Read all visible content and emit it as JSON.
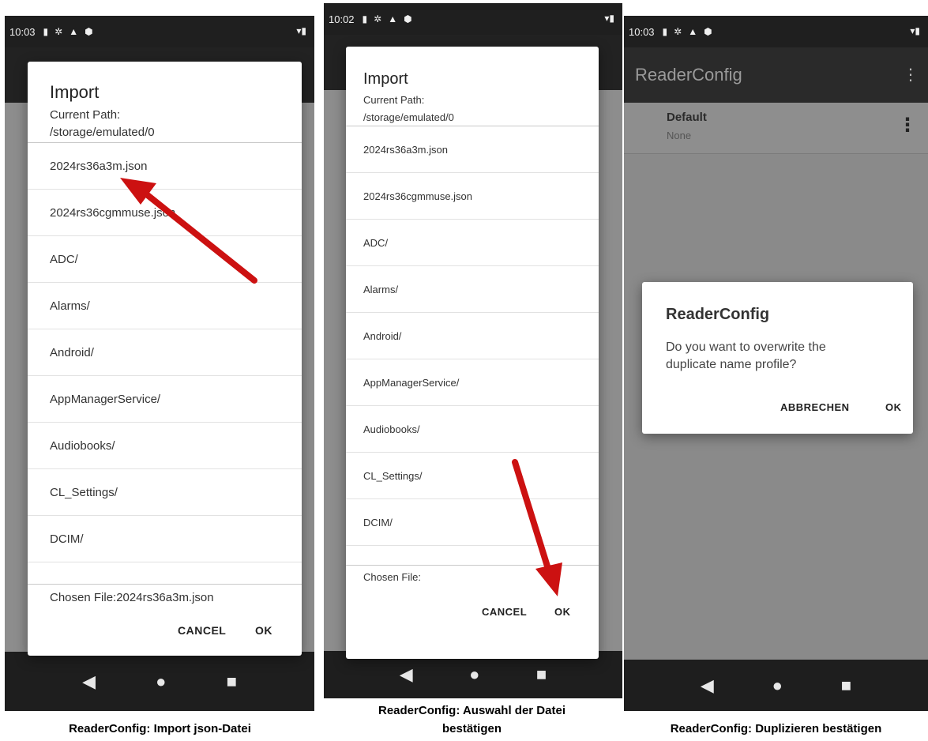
{
  "screen1": {
    "status": {
      "time": "10:03"
    },
    "dialog": {
      "title": "Import",
      "path_label": "Current Path:",
      "path_value": "/storage/emulated/0",
      "files": [
        "2024rs36a3m.json",
        "2024rs36cgmmuse.json",
        "ADC/",
        "Alarms/",
        "Android/",
        "AppManagerService/",
        "Audiobooks/",
        "CL_Settings/",
        "DCIM/"
      ],
      "chosen": "Chosen File:2024rs36a3m.json",
      "cancel": "CANCEL",
      "ok": "OK"
    },
    "caption": "ReaderConfig: Import json-Datei"
  },
  "screen2": {
    "status": {
      "time": "10:02"
    },
    "dialog": {
      "title": "Import",
      "path_label": "Current Path:",
      "path_value": "/storage/emulated/0",
      "files": [
        "2024rs36a3m.json",
        "2024rs36cgmmuse.json",
        "ADC/",
        "Alarms/",
        "Android/",
        "AppManagerService/",
        "Audiobooks/",
        "CL_Settings/",
        "DCIM/"
      ],
      "chosen": "Chosen File:",
      "cancel": "CANCEL",
      "ok": "OK"
    },
    "caption_line1": "ReaderConfig: Auswahl der Datei",
    "caption_line2": "bestätigen"
  },
  "screen3": {
    "status": {
      "time": "10:03"
    },
    "appbar_title": "ReaderConfig",
    "profile": {
      "name": "Default",
      "sub": "None"
    },
    "dialog": {
      "title": "ReaderConfig",
      "message": "Do you want to overwrite the duplicate name profile?",
      "cancel": "ABBRECHEN",
      "ok": "OK"
    },
    "caption": "ReaderConfig: Duplizieren bestätigen"
  },
  "colors": {
    "arrow": "#cc1111",
    "statusbar": "#1f1f1f",
    "scrim": "#8d8d8d"
  }
}
